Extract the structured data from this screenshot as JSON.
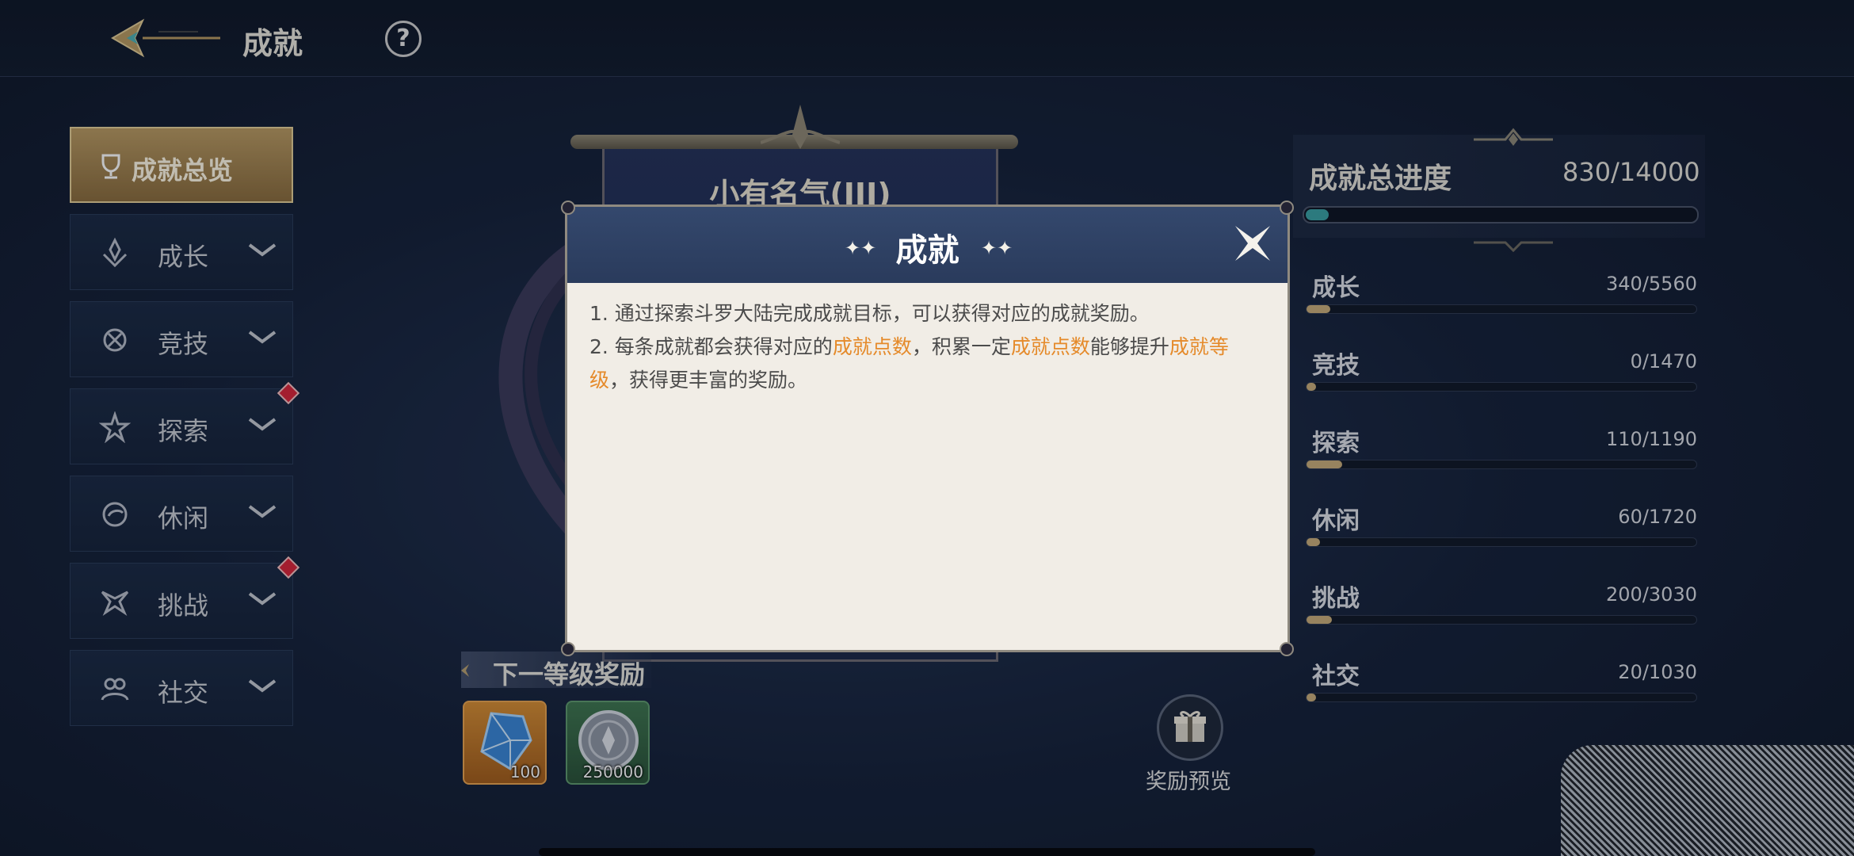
{
  "header": {
    "title": "成就",
    "help_symbol": "?"
  },
  "sidebar": {
    "items": [
      {
        "label": "成就总览",
        "icon": "trophy-icon"
      },
      {
        "label": "成长",
        "icon": "growth-icon"
      },
      {
        "label": "竞技",
        "icon": "arena-icon"
      },
      {
        "label": "探索",
        "icon": "explore-icon"
      },
      {
        "label": "休闲",
        "icon": "leisure-icon"
      },
      {
        "label": "挑战",
        "icon": "challenge-icon"
      },
      {
        "label": "社交",
        "icon": "social-icon"
      }
    ]
  },
  "banner": {
    "title": "小有名气(III)"
  },
  "next_rewards": {
    "title": "下一等级奖励",
    "items": [
      {
        "name": "blue-crystal",
        "quantity": "100"
      },
      {
        "name": "silver-coin",
        "quantity": "250000"
      }
    ],
    "preview_label": "奖励预览"
  },
  "progress": {
    "total_label": "成就总进度",
    "total_value": "830/14000",
    "total_fraction": 0.059,
    "categories": [
      {
        "label": "成长",
        "value": "340/5560",
        "fraction": 0.061
      },
      {
        "label": "竞技",
        "value": "0/1470",
        "fraction": 0.0
      },
      {
        "label": "探索",
        "value": "110/1190",
        "fraction": 0.092
      },
      {
        "label": "休闲",
        "value": "60/1720",
        "fraction": 0.035
      },
      {
        "label": "挑战",
        "value": "200/3030",
        "fraction": 0.066
      },
      {
        "label": "社交",
        "value": "20/1030",
        "fraction": 0.019
      }
    ]
  },
  "modal": {
    "title": "成就",
    "line1": "1. 通过探索斗罗大陆完成成就目标，可以获得对应的成就奖励。",
    "line2_a": "2. 每条成就都会获得对应的",
    "line2_hl1": "成就点数",
    "line2_b": "，积累一定",
    "line2_hl2": "成就点数",
    "line2_c": "能够提升",
    "line2_hl3": "成就等级",
    "line2_d": "，获得更丰富的奖励。"
  },
  "colors": {
    "highlight": "#e58a2a",
    "progress_fill": "#c9ad7a",
    "total_fill": "#3aa0a3",
    "badge": "#d9263a"
  }
}
